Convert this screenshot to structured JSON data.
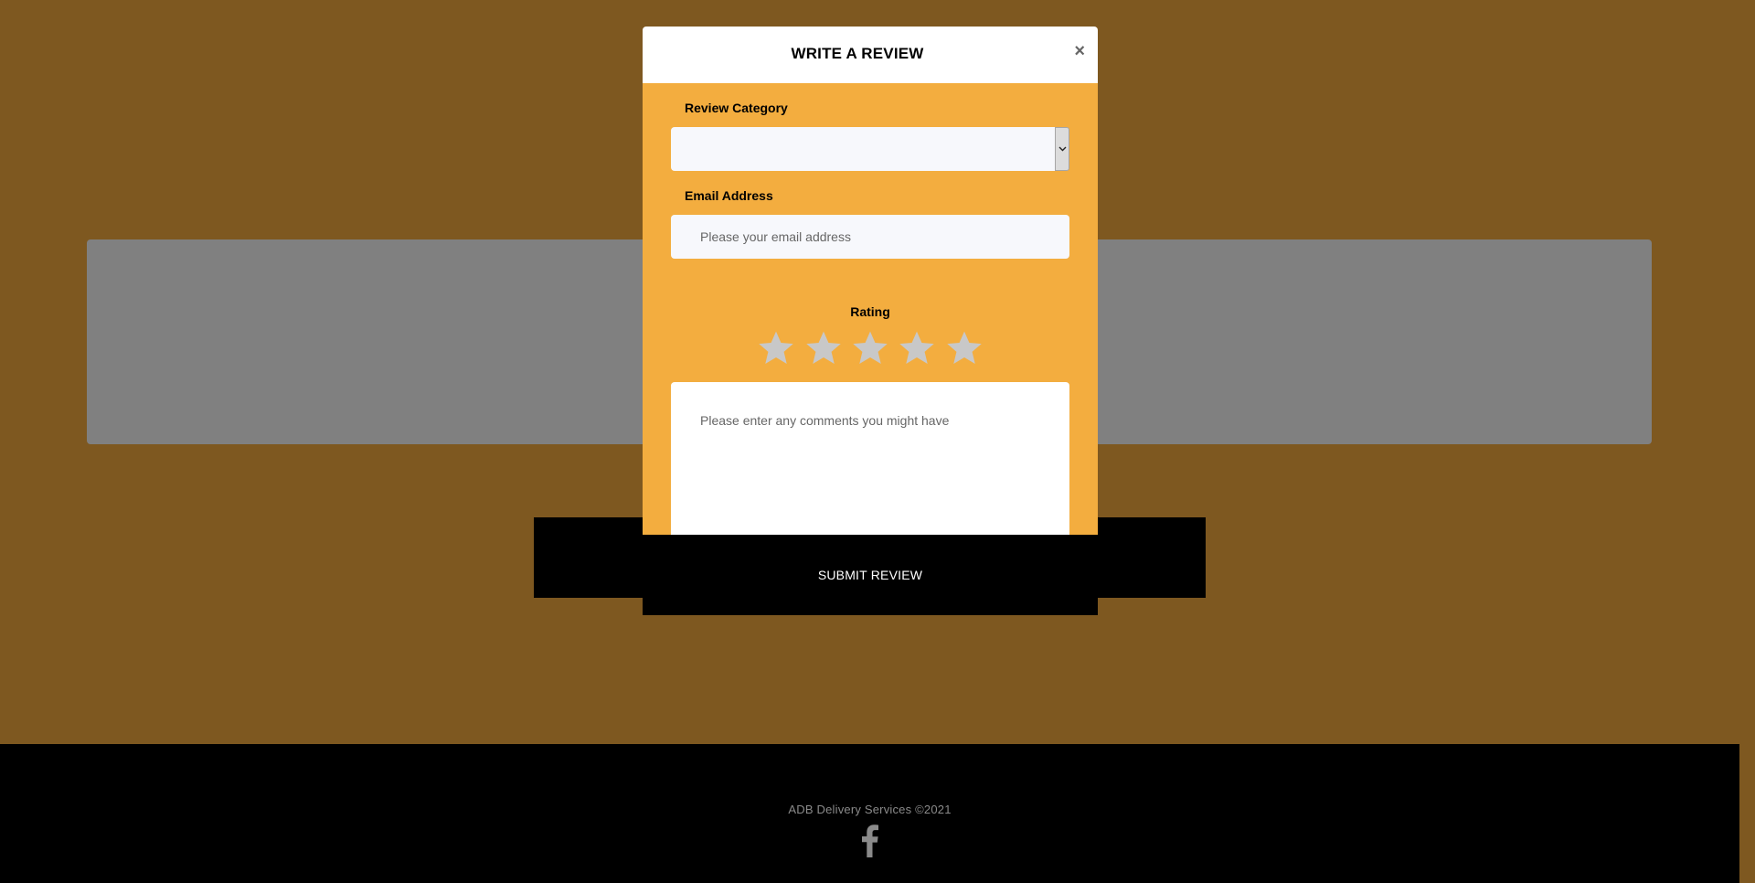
{
  "modal": {
    "title": "WRITE A REVIEW",
    "close_symbol": "×",
    "category": {
      "label": "Review Category",
      "selected_value": ""
    },
    "email": {
      "label": "Email Address",
      "value": "",
      "placeholder": "Please your email address"
    },
    "rating": {
      "label": "Rating",
      "value": 0,
      "max": 5,
      "star_color": "#c8c8c8"
    },
    "comments": {
      "value": "",
      "placeholder": "Please enter any comments you might have"
    },
    "submit_label": "SUBMIT REVIEW"
  },
  "footer": {
    "copyright": "ADB Delivery Services ©2021",
    "social_icon": "facebook-icon"
  },
  "colors": {
    "page_background": "#7e5820",
    "modal_body": "#f3ad3f",
    "dimmed_panel": "#808080",
    "footer_background": "#000000",
    "button_background": "#000000"
  }
}
